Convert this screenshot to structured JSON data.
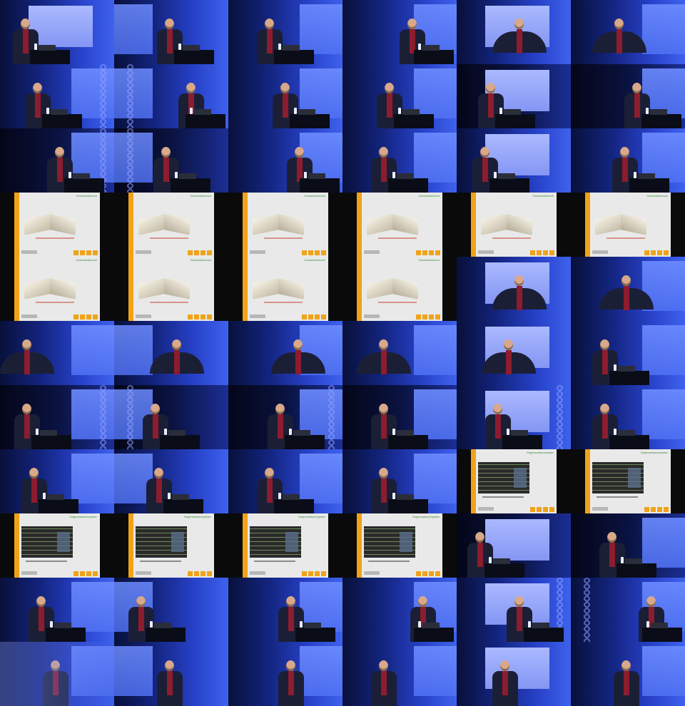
{
  "grid": {
    "columns": 6,
    "rows": 11
  },
  "colors": {
    "stage_blue": "#2741c8",
    "stage_dark": "#08103a",
    "slide_background": "#e9e9e9",
    "slide_accent_orange": "#f0a318",
    "slide_title_green": "#3c8a3c",
    "shirt_red": "#8c1c2e"
  },
  "slides": {
    "book_title": "Gesendeterbuch",
    "code_title": "Gegenwartscomputer"
  },
  "frames": [
    "stage-center",
    "stage",
    "stage",
    "stage",
    "stage",
    "stage",
    "stage",
    "stage",
    "stage",
    "stage",
    "stage",
    "stage",
    "stage",
    "stage",
    "stage",
    "stage",
    "stage",
    "stage",
    "slide-book",
    "slide-book",
    "slide-book",
    "slide-book",
    "slide-book",
    "slide-book",
    "slide-book",
    "slide-book",
    "slide-book",
    "slide-book",
    "stage",
    "stage",
    "stage",
    "stage",
    "stage",
    "stage",
    "stage",
    "stage",
    "stage",
    "stage",
    "stage",
    "stage",
    "stage",
    "stage",
    "stage",
    "stage",
    "stage",
    "stage",
    "slide-code",
    "slide-code",
    "slide-code",
    "slide-code",
    "slide-code",
    "slide-code",
    "stage",
    "stage",
    "stage",
    "stage",
    "stage",
    "stage",
    "stage",
    "stage",
    "stage",
    "stage",
    "stage",
    "stage",
    "stage",
    "stage"
  ]
}
